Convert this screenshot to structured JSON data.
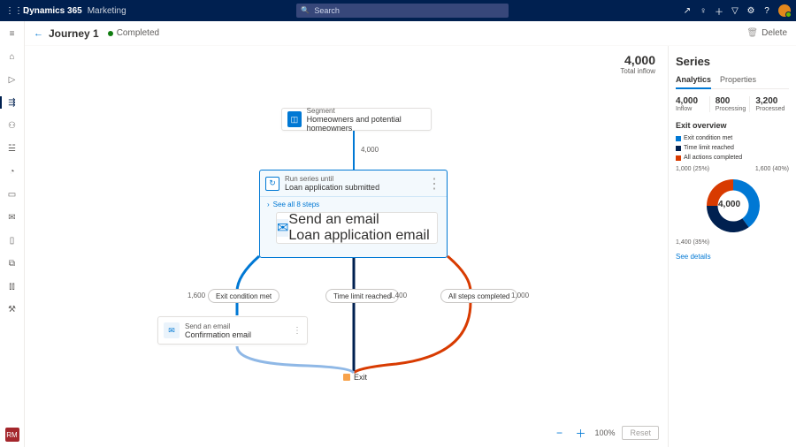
{
  "topbar": {
    "brand": "Dynamics 365",
    "area": "Marketing",
    "search_placeholder": "Search"
  },
  "header": {
    "title": "Journey 1",
    "status": "Completed",
    "delete": "Delete"
  },
  "canvas": {
    "total_inflow_num": "4,000",
    "total_inflow_lbl": "Total inflow",
    "segment": {
      "type": "Segment",
      "label": "Homeowners and potential homeowners"
    },
    "flow_to_series": "4,000",
    "series": {
      "type": "Run series until",
      "label": "Loan application submitted",
      "see_all": "See all 8 steps",
      "step": {
        "type": "Send an email",
        "label": "Loan application email"
      }
    },
    "branches": {
      "exit_cond": {
        "label": "Exit condition met",
        "count": "1,600"
      },
      "time_limit": {
        "label": "Time limit reached",
        "count": "1,400"
      },
      "all_steps": {
        "label": "All steps completed",
        "count": "1,000"
      }
    },
    "email2": {
      "type": "Send an email",
      "label": "Confirmation email"
    },
    "exit": "Exit",
    "zoom": {
      "pct": "100%",
      "reset": "Reset"
    }
  },
  "panel": {
    "title": "Series",
    "tabs": {
      "analytics": "Analytics",
      "properties": "Properties"
    },
    "stats": [
      {
        "n": "4,000",
        "l": "Inflow"
      },
      {
        "n": "800",
        "l": "Processing"
      },
      {
        "n": "3,200",
        "l": "Processed"
      }
    ],
    "exit_overview": "Exit overview",
    "legend": {
      "exit": "Exit condition met",
      "time": "Time limit reached",
      "all": "All actions completed"
    },
    "donut": {
      "center": "4,000",
      "tl": "1,000 (25%)",
      "tr": "1,600 (40%)",
      "bl": "1,400 (35%)"
    },
    "see_details": "See details"
  },
  "chart_data": {
    "type": "pie",
    "title": "Exit overview",
    "series": [
      {
        "name": "Exit condition met",
        "value": 1600,
        "pct": 40,
        "color": "#0078d4"
      },
      {
        "name": "Time limit reached",
        "value": 1400,
        "pct": 35,
        "color": "#002050"
      },
      {
        "name": "All actions completed",
        "value": 1000,
        "pct": 25,
        "color": "#d83b01"
      }
    ],
    "total": 4000
  }
}
